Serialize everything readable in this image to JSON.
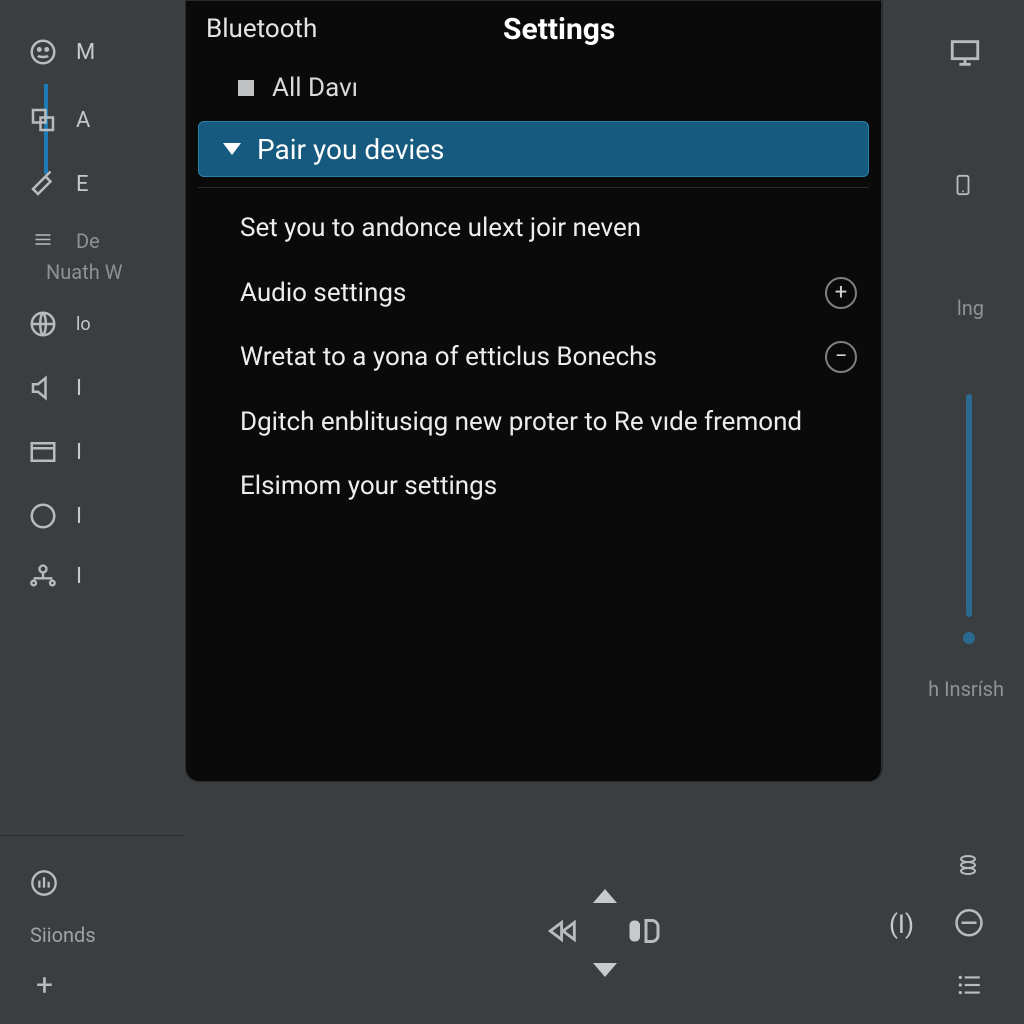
{
  "sidebar": {
    "items": [
      {
        "label": "M"
      },
      {
        "label": "A"
      },
      {
        "label": "E"
      },
      {
        "label": "De"
      }
    ],
    "group_label": "Nuath W",
    "lower": [
      {
        "label": "lo"
      },
      {
        "label": "I"
      },
      {
        "label": "I"
      },
      {
        "label": "I"
      },
      {
        "label": "I"
      }
    ],
    "bottom_label": "Siionds"
  },
  "rightcol": {
    "label_top": "lng",
    "label_bottom": "h Insrísh"
  },
  "modal": {
    "header_left": "Bluetooth",
    "header_title": "Settings",
    "all_label": "All Davı",
    "active_label": "Pair you devies",
    "entries": [
      {
        "text": "Set you to andonce ulext joir neven",
        "badge": null
      },
      {
        "text": "Audio settings",
        "badge": "plus"
      },
      {
        "text": "Wretat to a yona of etticlus Bonechs",
        "badge": "minus"
      },
      {
        "text": "Dgitch enblitusiqg new proter to Re vıde fremond",
        "badge": null
      },
      {
        "text": "Elsimom your settings",
        "badge": null
      }
    ]
  },
  "mediabar": {
    "power_label": "(I)"
  }
}
